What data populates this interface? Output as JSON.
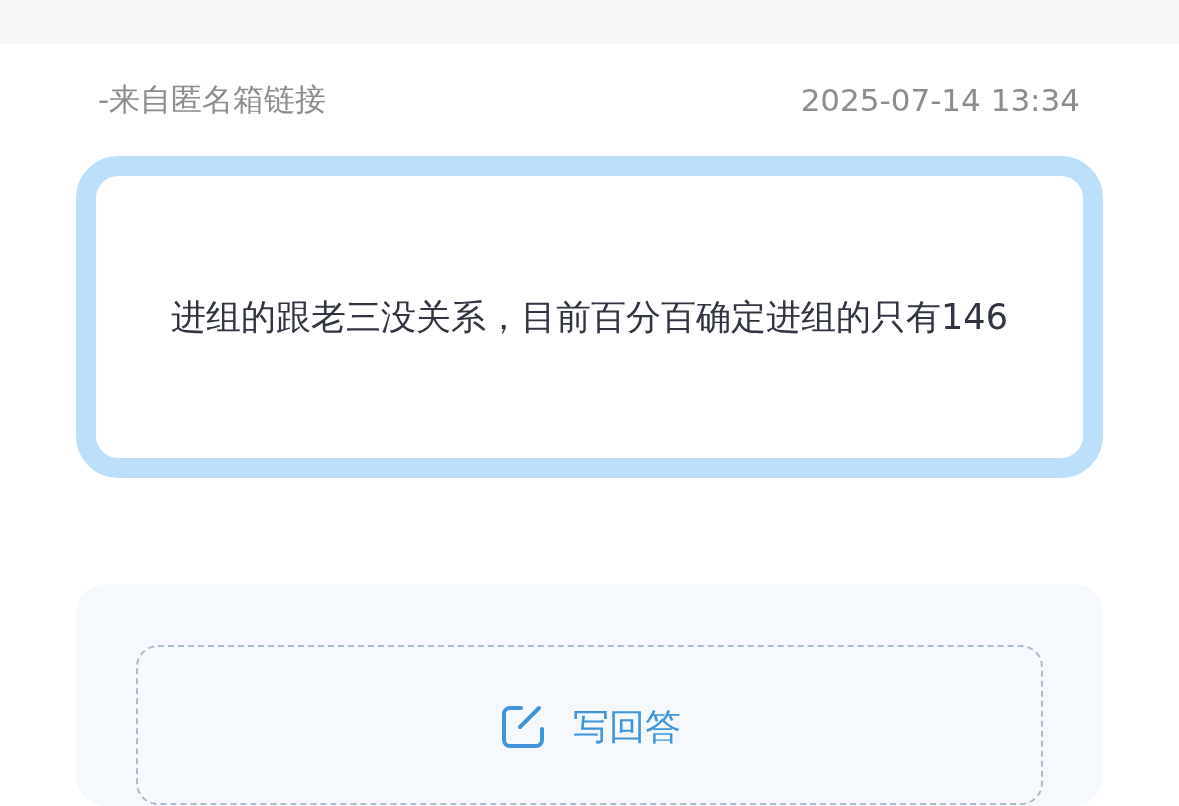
{
  "source": "-来自匿名箱链接",
  "time": "2025-07-14 13:34",
  "question": "进组的跟老三没关系，目前百分百确定进组的只有146",
  "answer_button": {
    "label": "写回答"
  }
}
